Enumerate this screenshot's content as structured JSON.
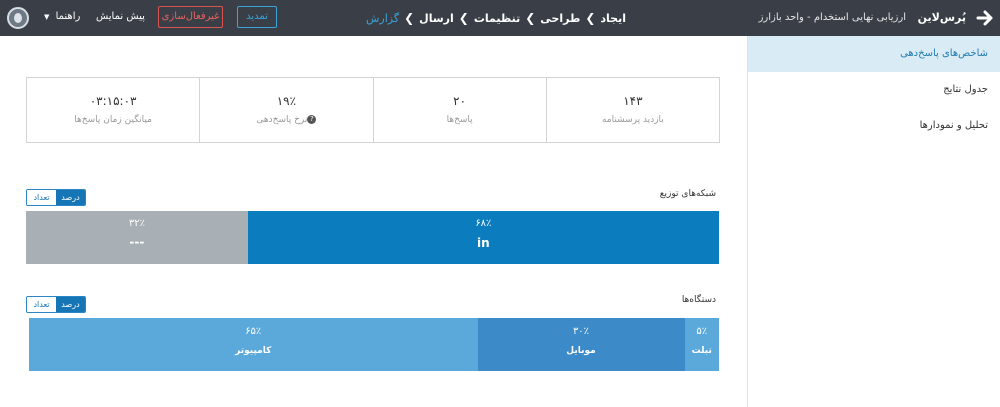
{
  "header": {
    "brand": "پُرس‌لاین",
    "form_title": "ارزیابی نهایی استخدام - واحد بازارز",
    "nav": [
      "ایجاد",
      "طراحی",
      "تنظیمات",
      "ارسال",
      "گزارش"
    ],
    "deactivate_label": "غیرفعال‌سازی",
    "extend_label": "تمدید",
    "preview_label": "پیش نمایش",
    "help_label": "راهنما"
  },
  "sidebar": {
    "items": [
      {
        "label": "شاخص‌های پاسخ‌دهی"
      },
      {
        "label": "جدول نتایج"
      },
      {
        "label": "تحلیل و نمودارها"
      }
    ]
  },
  "stats": [
    {
      "value": "۱۴۳",
      "label": "بازدید پرسشنامه"
    },
    {
      "value": "۲۰",
      "label": "پاسخ‌ها"
    },
    {
      "value": "۱۹٪",
      "label": "نرخ پاسخ‌دهی"
    },
    {
      "value": "۰۳:۱۵:۰۳",
      "label": "میانگین زمان پاسخ‌ها"
    }
  ],
  "distribution": {
    "title": "شبکه‌های توزیع",
    "toggle": {
      "percent": "درصد",
      "count": "تعداد"
    },
    "segments": [
      {
        "pct": "۶۸٪",
        "share": 68,
        "icon": "in",
        "icon_name": "linkedin-icon",
        "color": "#0b7dbf"
      },
      {
        "pct": "۳۲٪",
        "share": 32,
        "icon": "---",
        "icon_name": "other-icon",
        "color": "#a9b0b5"
      }
    ]
  },
  "devices": {
    "title": "دستگاه‌ها",
    "toggle": {
      "percent": "درصد",
      "count": "تعداد"
    },
    "segments": [
      {
        "pct": "۵٪",
        "share": 5,
        "name": "تبلت",
        "color": "#5ba8db"
      },
      {
        "pct": "۳۰٪",
        "share": 30,
        "name": "موبایل",
        "color": "#3c8ac7"
      },
      {
        "pct": "۶۵٪",
        "share": 65,
        "name": "کامپیوتر",
        "color": "#5ba8db"
      }
    ]
  }
}
